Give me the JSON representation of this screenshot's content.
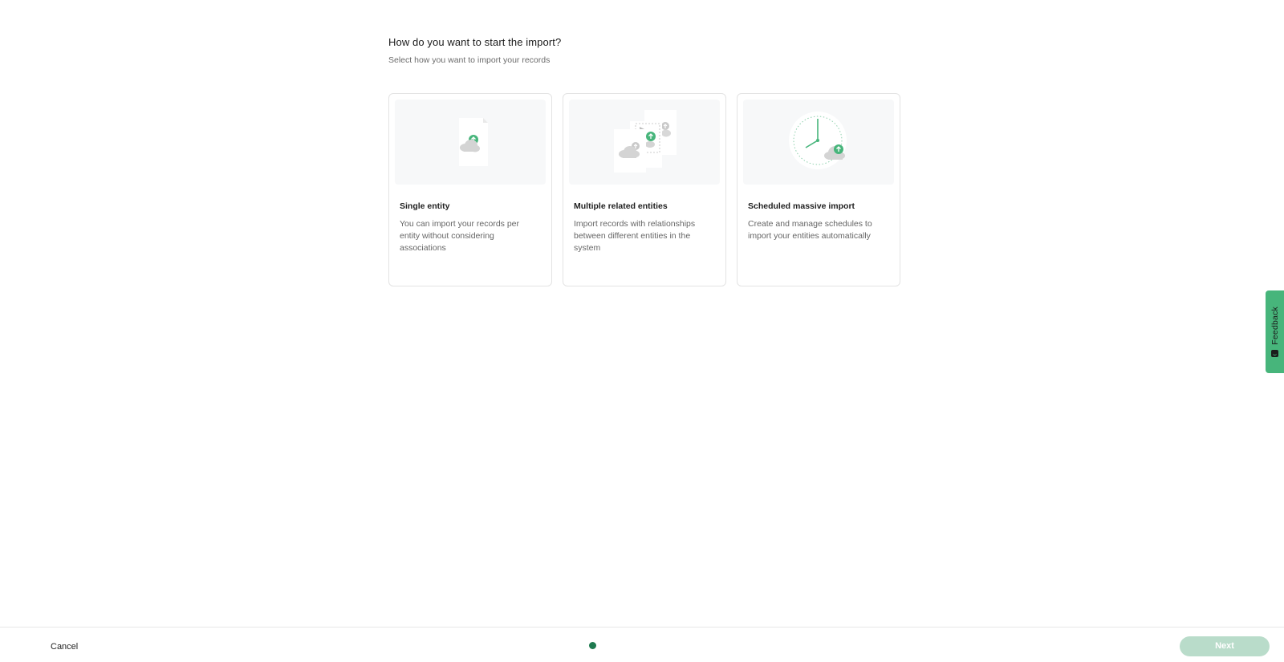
{
  "header": {
    "title": "How do you want to start the import?",
    "subtitle": "Select how you want to import your records"
  },
  "options": [
    {
      "title": "Single entity",
      "description": "You can import your records per entity without considering associations",
      "illustration": "single-file-upload-icon"
    },
    {
      "title": "Multiple related entities",
      "description": "Import records with relationships between different entities in the system",
      "illustration": "multiple-files-upload-icon"
    },
    {
      "title": "Scheduled massive import",
      "description": "Create and manage schedules to import your entities automatically",
      "illustration": "clock-upload-icon"
    }
  ],
  "footer": {
    "cancel_label": "Cancel",
    "next_label": "Next",
    "step_indicator_color": "#1e7a4f",
    "next_disabled": true
  },
  "feedback": {
    "label": "Feedback"
  },
  "colors": {
    "accent": "#47b57b",
    "next_disabled_bg": "#b9dcca"
  }
}
